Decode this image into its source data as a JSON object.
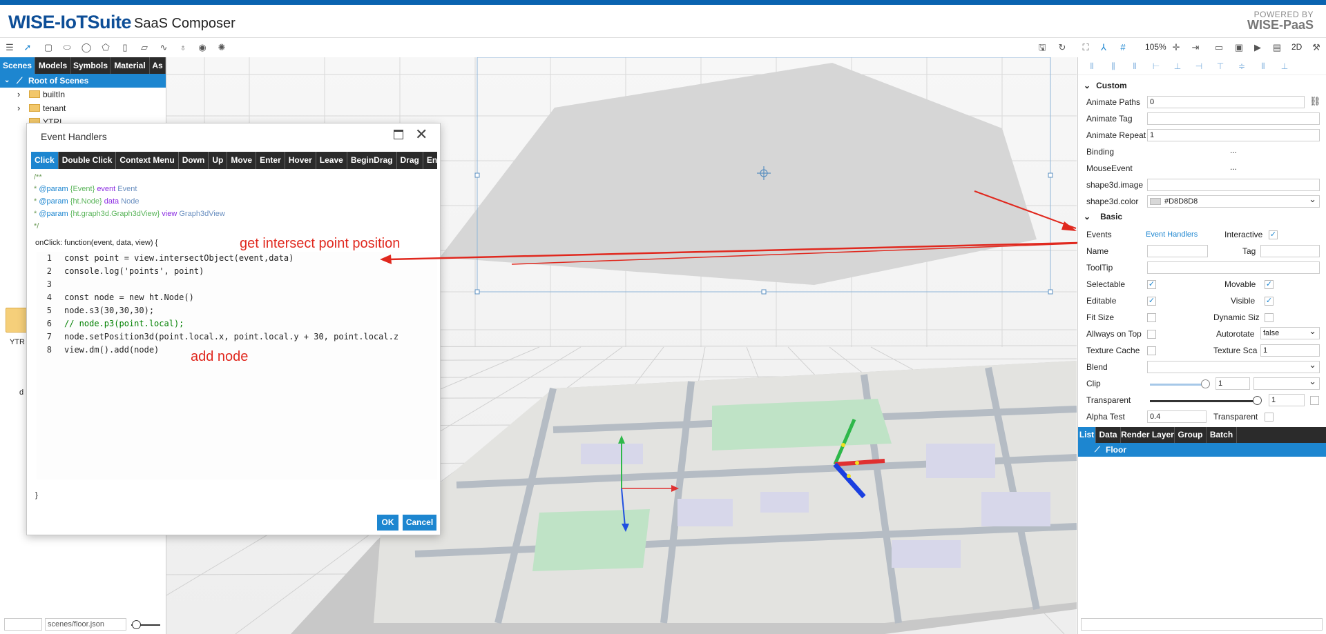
{
  "header": {
    "logo": "WISE-IoTSuite",
    "subtitle": "SaaS Composer",
    "powered_by_line1": "POWERED BY",
    "powered_by_line2": "WISE-PaaS"
  },
  "toolbar": {
    "zoom": "105%",
    "mode_2d": "2D"
  },
  "left_tabs": [
    "Scenes",
    "Models",
    "Symbols",
    "Material",
    "As"
  ],
  "tree": {
    "root": "Root of Scenes",
    "items": [
      "builtIn",
      "tenant",
      "YTRI"
    ]
  },
  "left_misc": {
    "ytr_label": "YTR",
    "d_label": "d",
    "path_value": "scenes/floor.json"
  },
  "dialog": {
    "title": "Event Handlers",
    "tabs": [
      "Click",
      "Double Click",
      "Context Menu",
      "Down",
      "Up",
      "Move",
      "Enter",
      "Hover",
      "Leave",
      "BeginDrag",
      "Drag",
      "End"
    ],
    "doc_open": "/**",
    "doc_lines": [
      {
        "tag": "@param",
        "type": "{Event}",
        "name": "event",
        "desc": "Event"
      },
      {
        "tag": "@param",
        "type": "{ht.Node}",
        "name": "data",
        "desc": "Node"
      },
      {
        "tag": "@param",
        "type": "{ht.graph3d.Graph3dView}",
        "name": "view",
        "desc": "Graph3dView"
      }
    ],
    "doc_close": "*/",
    "signature": "onClick: function(event, data, view) {",
    "closing_brace": "}",
    "code_lines": [
      {
        "n": "1",
        "text": "const point = view.intersectObject(event,data)"
      },
      {
        "n": "2",
        "text": "console.log('points', point)"
      },
      {
        "n": "3",
        "text": ""
      },
      {
        "n": "4",
        "text": "const node = new ht.Node()"
      },
      {
        "n": "5",
        "text": "node.s3(30,30,30);"
      },
      {
        "n": "6",
        "text": "// node.p3(point.local);"
      },
      {
        "n": "7",
        "text": "node.setPosition3d(point.local.x, point.local.y + 30, point.local.z"
      },
      {
        "n": "8",
        "text": "view.dm().add(node)"
      }
    ],
    "ok_label": "OK",
    "cancel_label": "Cancel"
  },
  "annotations": {
    "intersect": "get intersect point position",
    "add_node": "add node"
  },
  "properties": {
    "custom_section": "Custom",
    "animate_paths_label": "Animate Paths",
    "animate_paths_value": "0",
    "animate_tag_label": "Animate Tag",
    "animate_tag_value": "",
    "animate_repeat_label": "Animate Repeat",
    "animate_repeat_value": "1",
    "binding_label": "Binding",
    "binding_value": "...",
    "mouse_event_label": "MouseEvent",
    "mouse_event_value": "...",
    "shape_image_label": "shape3d.image",
    "shape_color_label": "shape3d.color",
    "shape_color_value": "#D8D8D8",
    "basic_section": "Basic",
    "events_label": "Events",
    "events_value": "Event Handlers",
    "interactive_label": "Interactive",
    "name_label": "Name",
    "tag_label": "Tag",
    "tooltip_label": "ToolTip",
    "selectable_label": "Selectable",
    "movable_label": "Movable",
    "editable_label": "Editable",
    "visible_label": "Visible",
    "fit_size_label": "Fit Size",
    "dynamic_size_label": "Dynamic Siz",
    "always_on_top_label": "Allways on Top",
    "autorotate_label": "Autorotate",
    "autorotate_value": "false",
    "texture_cache_label": "Texture Cache",
    "texture_scale_label": "Texture Sca",
    "texture_scale_value": "1",
    "blend_label": "Blend",
    "clip_label": "Clip",
    "clip_value": "1",
    "transparent_label": "Transparent",
    "transparent_value": "1",
    "alpha_test_label": "Alpha Test",
    "alpha_test_value": "0.4",
    "transparent2_label": "Transparent"
  },
  "right_tabs": [
    "List",
    "Data",
    "Render Layer",
    "Group",
    "Batch"
  ],
  "list_item": "Floor",
  "colors": {
    "accent": "#1d86d0",
    "brand": "#0d4e97",
    "annotation": "#e0281e",
    "tab_bar": "#2b2b2b"
  }
}
